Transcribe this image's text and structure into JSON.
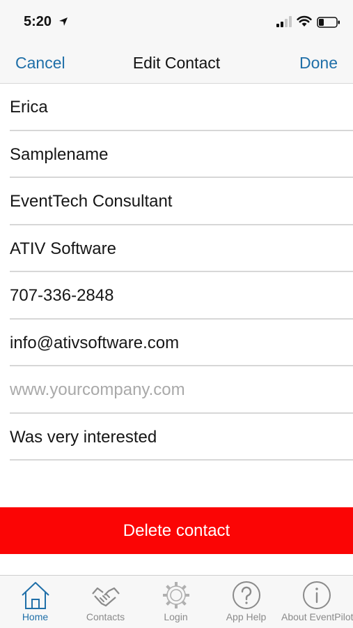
{
  "status_bar": {
    "time": "5:20"
  },
  "nav": {
    "cancel_label": "Cancel",
    "title": "Edit Contact",
    "done_label": "Done"
  },
  "fields": [
    {
      "value": "Erica",
      "placeholder": ""
    },
    {
      "value": "Samplename",
      "placeholder": ""
    },
    {
      "value": "EventTech Consultant",
      "placeholder": ""
    },
    {
      "value": "ATIV Software",
      "placeholder": ""
    },
    {
      "value": "707-336-2848",
      "placeholder": ""
    },
    {
      "value": "info@ativsoftware.com",
      "placeholder": ""
    },
    {
      "value": "",
      "placeholder": "www.yourcompany.com"
    },
    {
      "value": "Was very interested",
      "placeholder": ""
    }
  ],
  "delete_label": "Delete contact",
  "tabs": [
    {
      "label": "Home",
      "icon": "home-icon",
      "active": true
    },
    {
      "label": "Contacts",
      "icon": "handshake-icon",
      "active": false
    },
    {
      "label": "Login",
      "icon": "gear-icon",
      "active": false
    },
    {
      "label": "App Help",
      "icon": "question-icon",
      "active": false
    },
    {
      "label": "About EventPilot",
      "icon": "info-icon",
      "active": false
    }
  ],
  "colors": {
    "accent": "#1f6fa8",
    "danger": "#fb0505",
    "bar_bg": "#f7f7f7"
  }
}
